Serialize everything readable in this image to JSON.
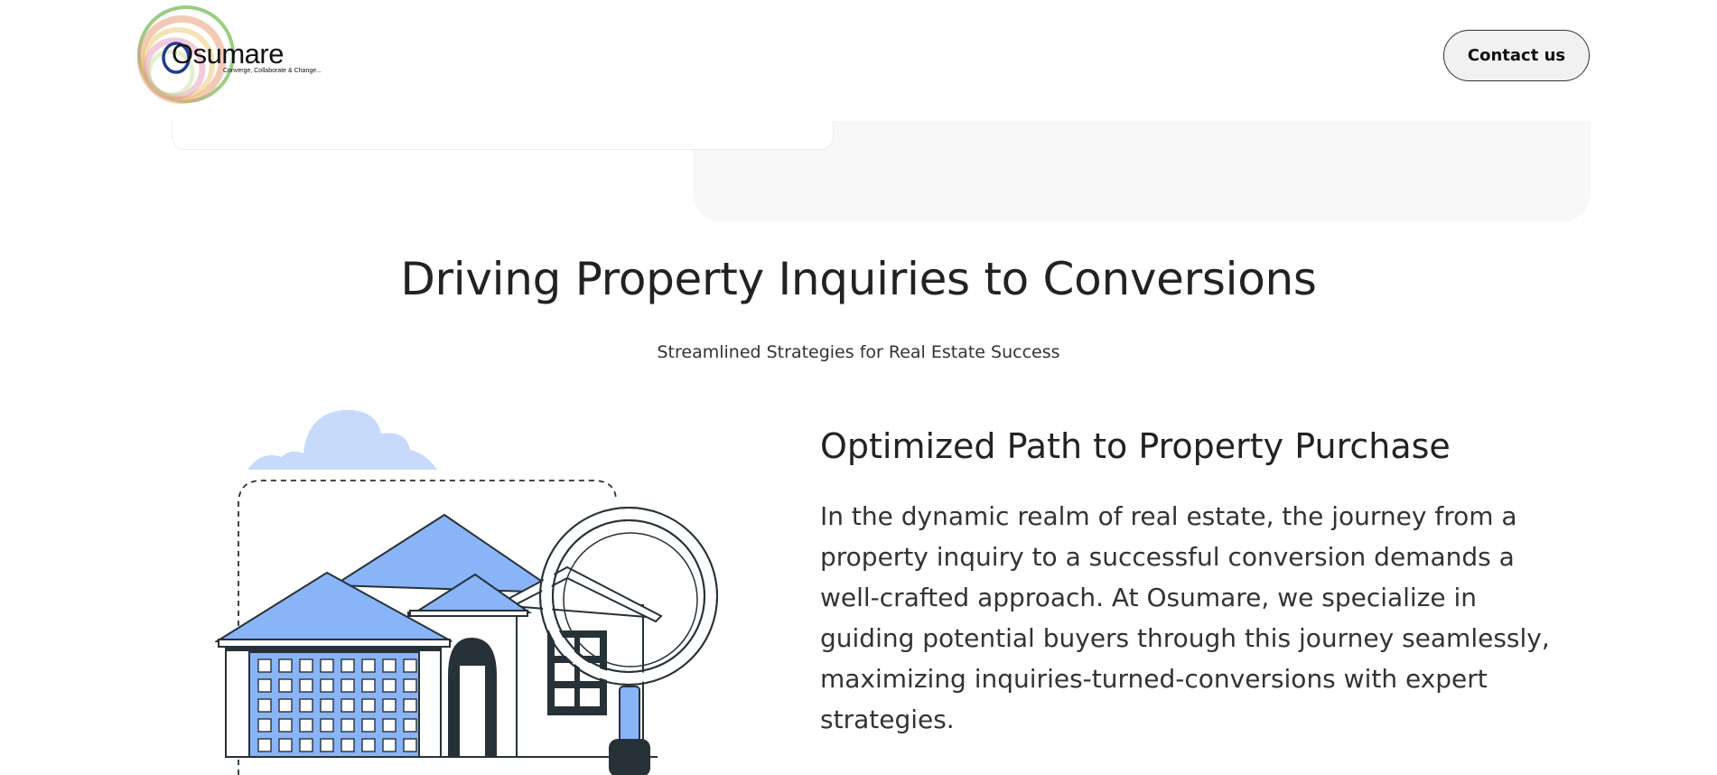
{
  "header": {
    "logo": {
      "name": "Osumare",
      "tagline": "Converge, Collaborate & Change..."
    },
    "contact_button": "Contact us"
  },
  "section": {
    "title": "Driving Property Inquiries to Conversions",
    "subtitle": "Streamlined Strategies for Real Estate Success"
  },
  "content": {
    "title": "Optimized Path to Property Purchase",
    "body": "In the dynamic realm of real estate, the journey from a property inquiry to a successful conversion demands a well-crafted approach. At Osumare, we specialize in guiding potential buyers through this journey seamlessly, maximizing inquiries-turned-conversions with expert strategies."
  },
  "illustration": {
    "icon": "house-magnifier-illustration",
    "colors": {
      "accent": "#8ab4f8",
      "cloud": "#c8dafc",
      "dark": "#263238"
    }
  }
}
